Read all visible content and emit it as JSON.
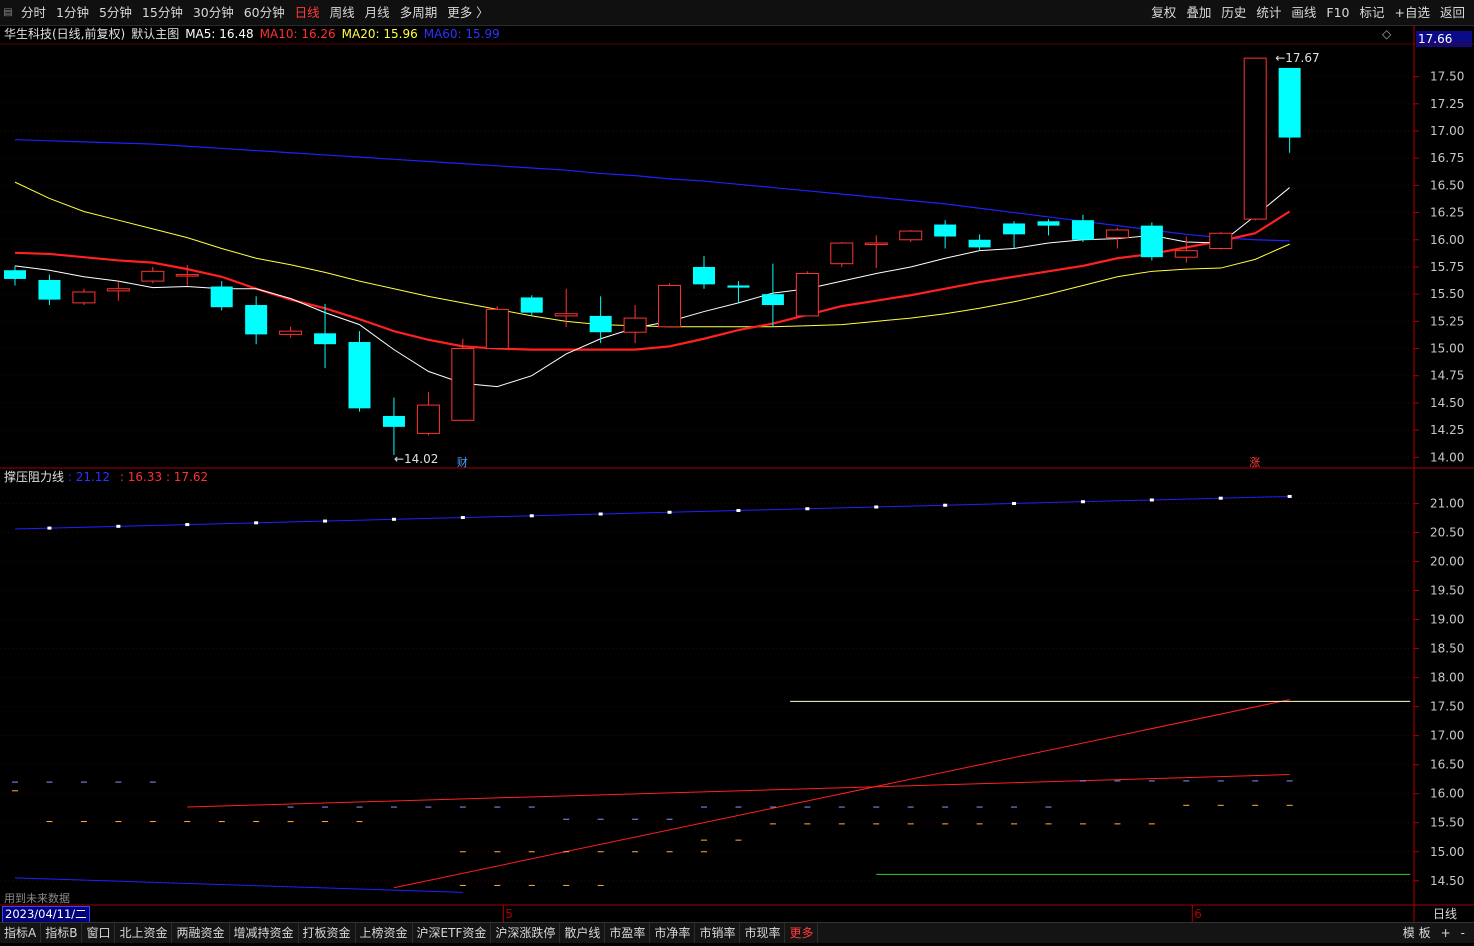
{
  "topbar": {
    "periods": [
      "分时",
      "1分钟",
      "5分钟",
      "15分钟",
      "30分钟",
      "60分钟",
      "日线",
      "周线",
      "月线",
      "多周期",
      "更多 〉"
    ],
    "active_period": "日线",
    "right_tools": [
      "复权",
      "叠加",
      "历史",
      "统计",
      "画线",
      "F10",
      "标记",
      "+自选",
      "返回"
    ]
  },
  "main_title": {
    "stock": "华生科技(日线,前复权)",
    "template": "默认主图",
    "ma5": "MA5: 16.48",
    "ma10": "MA10: 16.26",
    "ma20": "MA20: 15.96",
    "ma60": "MA60: 15.99"
  },
  "colors": {
    "up": "#ff3232",
    "down": "#00ffff",
    "ma5": "#ffffff",
    "ma10": "#ff2020",
    "ma20": "#ffff40",
    "ma60": "#2020ff",
    "axis": "#b00000",
    "grid": "#3a0000",
    "label_text": "#c8c8c8"
  },
  "corner_value": "17.66",
  "sub_title": {
    "name": "撑压阻力线",
    "v1": ": 21.12",
    "v2": ": 16.33",
    "v3": ": 17.62"
  },
  "markers": {
    "cai": "财",
    "zhang": "涨"
  },
  "future_note": "用到未来数据",
  "date_box": "2023/04/11/二",
  "day_line": "日线",
  "bottom_tabs": [
    "指标A",
    "指标B",
    "窗口",
    "北上资金",
    "两融资金",
    "增减持资金",
    "打板资金",
    "上榜资金",
    "沪深ETF资金",
    "沪深涨跌停",
    "散户线",
    "市盈率",
    "市净率",
    "市销率",
    "市现率",
    "更多"
  ],
  "bottom_right": [
    "模 板",
    "+",
    "-"
  ],
  "chart_data": [
    {
      "type": "candlestick",
      "title": "华生科技(日线,前复权)",
      "y_ticks": [
        14.0,
        14.25,
        14.5,
        14.75,
        15.0,
        15.25,
        15.5,
        15.75,
        16.0,
        16.25,
        16.5,
        16.75,
        17.0,
        17.25,
        17.5
      ],
      "ylim": [
        13.92,
        17.8
      ],
      "x_month_labels": [
        {
          "index": 14,
          "label": "5"
        },
        {
          "index": 34,
          "label": "6"
        }
      ],
      "annotations": [
        {
          "index": 11,
          "price": 14.02,
          "text": "←14.02"
        },
        {
          "index": 36,
          "price": 17.67,
          "text": "←17.67"
        }
      ],
      "candles": [
        {
          "o": 15.72,
          "h": 15.76,
          "l": 15.58,
          "c": 15.64
        },
        {
          "o": 15.63,
          "h": 15.68,
          "l": 15.4,
          "c": 15.45
        },
        {
          "o": 15.42,
          "h": 15.55,
          "l": 15.4,
          "c": 15.52
        },
        {
          "o": 15.53,
          "h": 15.61,
          "l": 15.44,
          "c": 15.55
        },
        {
          "o": 15.62,
          "h": 15.75,
          "l": 15.6,
          "c": 15.71
        },
        {
          "o": 15.67,
          "h": 15.77,
          "l": 15.58,
          "c": 15.68
        },
        {
          "o": 15.57,
          "h": 15.62,
          "l": 15.35,
          "c": 15.38
        },
        {
          "o": 15.4,
          "h": 15.48,
          "l": 15.04,
          "c": 15.13
        },
        {
          "o": 15.13,
          "h": 15.2,
          "l": 15.1,
          "c": 15.16
        },
        {
          "o": 15.14,
          "h": 15.41,
          "l": 14.82,
          "c": 15.04
        },
        {
          "o": 15.06,
          "h": 15.16,
          "l": 14.42,
          "c": 14.45
        },
        {
          "o": 14.38,
          "h": 14.55,
          "l": 14.02,
          "c": 14.28
        },
        {
          "o": 14.22,
          "h": 14.6,
          "l": 14.2,
          "c": 14.48
        },
        {
          "o": 14.34,
          "h": 15.09,
          "l": 14.34,
          "c": 15.0
        },
        {
          "o": 15.0,
          "h": 15.39,
          "l": 15.0,
          "c": 15.36
        },
        {
          "o": 15.47,
          "h": 15.49,
          "l": 15.3,
          "c": 15.33
        },
        {
          "o": 15.3,
          "h": 15.55,
          "l": 15.2,
          "c": 15.32
        },
        {
          "o": 15.3,
          "h": 15.48,
          "l": 15.05,
          "c": 15.15
        },
        {
          "o": 15.15,
          "h": 15.4,
          "l": 15.05,
          "c": 15.28
        },
        {
          "o": 15.2,
          "h": 15.6,
          "l": 15.2,
          "c": 15.58
        },
        {
          "o": 15.75,
          "h": 15.85,
          "l": 15.55,
          "c": 15.59
        },
        {
          "o": 15.58,
          "h": 15.62,
          "l": 15.42,
          "c": 15.56
        },
        {
          "o": 15.5,
          "h": 15.78,
          "l": 15.2,
          "c": 15.4
        },
        {
          "o": 15.3,
          "h": 15.71,
          "l": 15.3,
          "c": 15.69
        },
        {
          "o": 15.78,
          "h": 15.98,
          "l": 15.75,
          "c": 15.97
        },
        {
          "o": 15.97,
          "h": 16.04,
          "l": 15.74,
          "c": 15.97
        },
        {
          "o": 16.0,
          "h": 16.09,
          "l": 15.98,
          "c": 16.08
        },
        {
          "o": 16.14,
          "h": 16.18,
          "l": 15.92,
          "c": 16.03
        },
        {
          "o": 16.0,
          "h": 16.05,
          "l": 15.9,
          "c": 15.93
        },
        {
          "o": 16.15,
          "h": 16.17,
          "l": 15.92,
          "c": 16.05
        },
        {
          "o": 16.17,
          "h": 16.19,
          "l": 16.04,
          "c": 16.13
        },
        {
          "o": 16.18,
          "h": 16.23,
          "l": 15.98,
          "c": 16.0
        },
        {
          "o": 16.02,
          "h": 16.11,
          "l": 15.92,
          "c": 16.09
        },
        {
          "o": 16.13,
          "h": 16.16,
          "l": 15.81,
          "c": 15.84
        },
        {
          "o": 15.84,
          "h": 16.03,
          "l": 15.79,
          "c": 15.9
        },
        {
          "o": 15.92,
          "h": 16.07,
          "l": 15.91,
          "c": 16.06
        },
        {
          "o": 16.19,
          "h": 17.67,
          "l": 16.18,
          "c": 17.67
        },
        {
          "o": 17.58,
          "h": 17.58,
          "l": 16.8,
          "c": 16.94
        }
      ],
      "ma5": [
        15.76,
        15.72,
        15.66,
        15.62,
        15.56,
        15.57,
        15.55,
        15.55,
        15.46,
        15.33,
        15.22,
        14.99,
        14.79,
        14.68,
        14.65,
        14.75,
        14.95,
        15.09,
        15.19,
        15.25,
        15.34,
        15.42,
        15.51,
        15.55,
        15.62,
        15.69,
        15.75,
        15.83,
        15.9,
        15.92,
        15.97,
        16.0,
        16.01,
        16.04,
        15.98,
        15.97,
        16.22,
        16.48
      ],
      "ma10": [
        15.88,
        15.87,
        15.84,
        15.81,
        15.79,
        15.73,
        15.66,
        15.55,
        15.45,
        15.37,
        15.27,
        15.16,
        15.08,
        15.02,
        15.0,
        14.99,
        14.99,
        14.99,
        14.99,
        15.02,
        15.09,
        15.17,
        15.23,
        15.31,
        15.39,
        15.44,
        15.49,
        15.55,
        15.61,
        15.66,
        15.71,
        15.76,
        15.83,
        15.87,
        15.93,
        15.99,
        16.06,
        16.26
      ],
      "ma20": [
        16.53,
        16.38,
        16.26,
        16.18,
        16.1,
        16.02,
        15.92,
        15.83,
        15.77,
        15.7,
        15.62,
        15.55,
        15.48,
        15.42,
        15.36,
        15.3,
        15.25,
        15.22,
        15.21,
        15.2,
        15.2,
        15.2,
        15.2,
        15.21,
        15.22,
        15.25,
        15.28,
        15.32,
        15.37,
        15.43,
        15.5,
        15.58,
        15.66,
        15.71,
        15.73,
        15.74,
        15.82,
        15.96
      ],
      "ma60": [
        16.92,
        16.91,
        16.9,
        16.89,
        16.88,
        16.86,
        16.84,
        16.82,
        16.8,
        16.78,
        16.76,
        16.74,
        16.72,
        16.7,
        16.68,
        16.66,
        16.64,
        16.61,
        16.59,
        16.56,
        16.54,
        16.51,
        16.48,
        16.45,
        16.42,
        16.39,
        16.36,
        16.33,
        16.29,
        16.25,
        16.21,
        16.17,
        16.13,
        16.09,
        16.05,
        16.02,
        16.0,
        15.99
      ]
    },
    {
      "type": "line",
      "title": "撑压阻力线",
      "y_ticks": [
        14.5,
        15.0,
        15.5,
        16.0,
        16.5,
        17.0,
        17.5,
        18.0,
        18.5,
        19.0,
        19.5,
        20.0,
        20.5,
        21.0
      ],
      "ylim": [
        14.1,
        21.3
      ],
      "series": [
        {
          "name": "21.12",
          "color": "#2020ff",
          "x0": 0,
          "y0": 20.56,
          "x1": 37,
          "y1": 21.12,
          "dot_every": 2
        },
        {
          "name": "16.33",
          "color": "#ff2020",
          "x0": 5,
          "y0": 15.77,
          "x1": 37,
          "y1": 16.33
        },
        {
          "name": "17.62",
          "color": "#ff2020",
          "x0": 11,
          "y0": 14.38,
          "x1": 37,
          "y1": 17.62
        },
        {
          "color": "#2020ff",
          "x0": 0,
          "y0": 14.55,
          "x1": 13,
          "y1": 14.3
        },
        {
          "color": "#ffffc0",
          "x0": 22.5,
          "y0": 17.59,
          "x1": 40.5,
          "y1": 17.59
        },
        {
          "color": "#30d030",
          "x0": 25,
          "y0": 14.61,
          "x1": 40.5,
          "y1": 14.61
        }
      ],
      "dashes": [
        {
          "color": "#9090ff",
          "y": 16.2,
          "from": 0,
          "to": 4
        },
        {
          "color": "#ffb040",
          "y": 16.05,
          "from": 0,
          "to": 0
        },
        {
          "color": "#ffb040",
          "y": 15.52,
          "from": 1,
          "to": 10
        },
        {
          "color": "#9090ff",
          "y": 15.77,
          "from": 8,
          "to": 15
        },
        {
          "color": "#9090ff",
          "y": 15.56,
          "from": 16,
          "to": 19
        },
        {
          "color": "#9090ff",
          "y": 15.77,
          "from": 20,
          "to": 30
        },
        {
          "color": "#ffb040",
          "y": 15.2,
          "from": 20,
          "to": 21
        },
        {
          "color": "#ffb040",
          "y": 15.48,
          "from": 22,
          "to": 33
        },
        {
          "color": "#ffb040",
          "y": 15.0,
          "from": 13,
          "to": 20
        },
        {
          "color": "#9090ff",
          "y": 16.22,
          "from": 31,
          "to": 37
        },
        {
          "color": "#ffb040",
          "y": 15.8,
          "from": 34,
          "to": 37
        },
        {
          "color": "#ffb040",
          "y": 14.42,
          "from": 13,
          "to": 17
        }
      ]
    }
  ]
}
